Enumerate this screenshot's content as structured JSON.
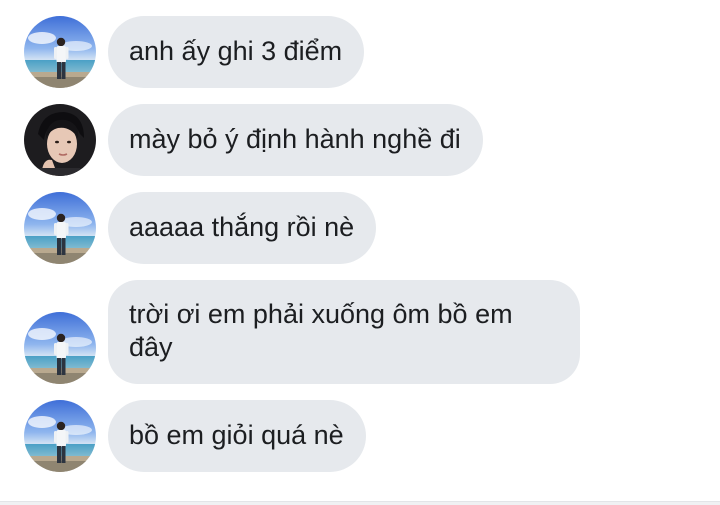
{
  "messages": [
    {
      "sender": "friend",
      "avatar": "beach-avatar",
      "text": "anh ấy ghi 3 điểm"
    },
    {
      "sender": "other",
      "avatar": "dark-avatar",
      "text": "mày bỏ ý định hành nghề đi"
    },
    {
      "sender": "friend",
      "avatar": "beach-avatar",
      "text": "aaaaa thắng rồi nè"
    },
    {
      "sender": "friend",
      "avatar": "beach-avatar",
      "text": "trời ơi em phải xuống ôm bồ em đây"
    },
    {
      "sender": "friend",
      "avatar": "beach-avatar",
      "text": "bồ em giỏi quá nè"
    }
  ],
  "colors": {
    "bubble": "#e6e9ed",
    "text": "#1c1e21",
    "background": "#ffffff"
  }
}
